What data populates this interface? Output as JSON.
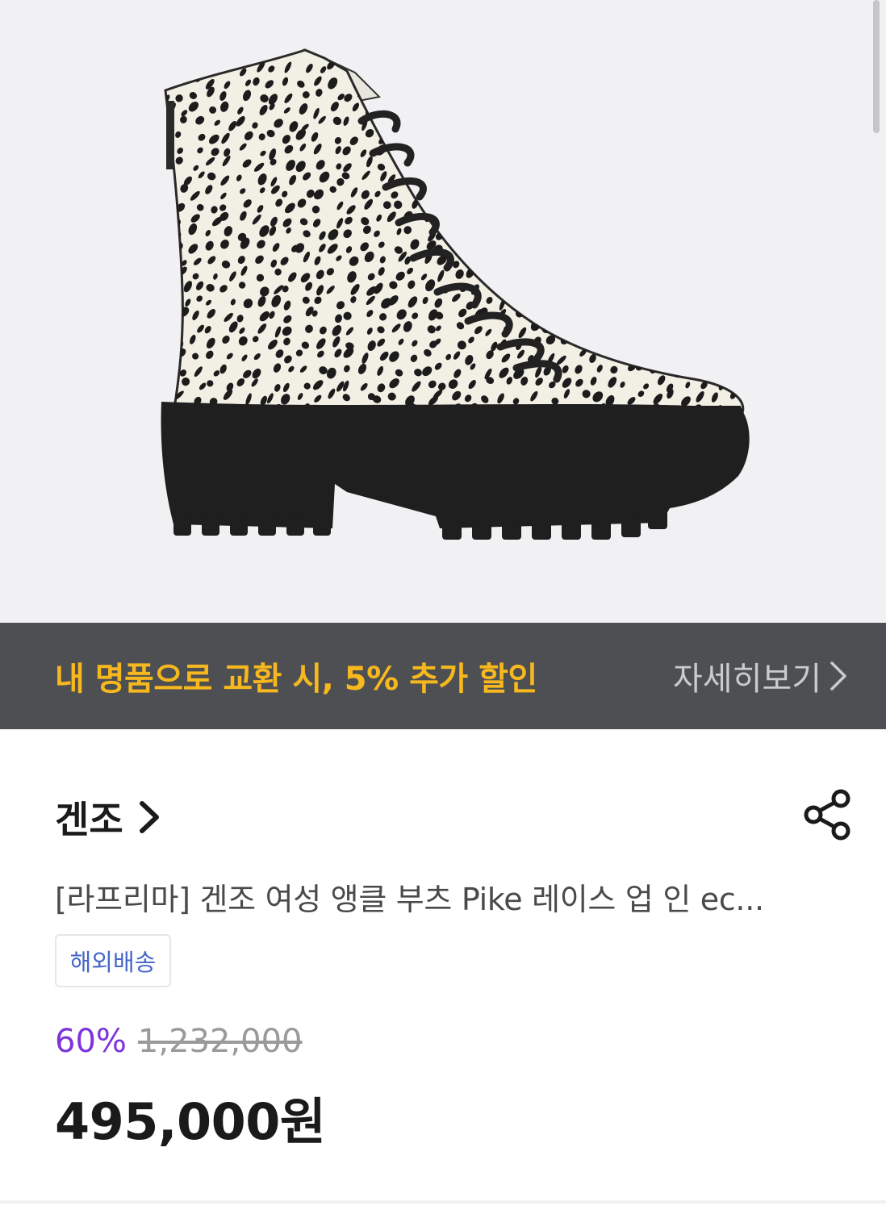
{
  "product_image": {
    "alt": "leopard print lace-up ankle boot",
    "bg_color": "#f1f1f3"
  },
  "promo": {
    "text": "내 명품으로 교환 시, 5% 추가 할인",
    "more_label": "자세히보기",
    "text_color": "#f6b81e",
    "bg_color": "#4d4f52"
  },
  "brand": {
    "name": "겐조"
  },
  "product": {
    "title": "[라프리마] 겐조 여성 앵클 부츠 Pike 레이스 업 인 ec...",
    "tag": "해외배송"
  },
  "price": {
    "discount": "60%",
    "original": "1,232,000",
    "final": "495,000원",
    "discount_color": "#7f33dc"
  },
  "icons": {
    "share": "share-icon",
    "brand_chevron": "chevron-right-icon",
    "promo_chevron": "chevron-right-icon"
  }
}
